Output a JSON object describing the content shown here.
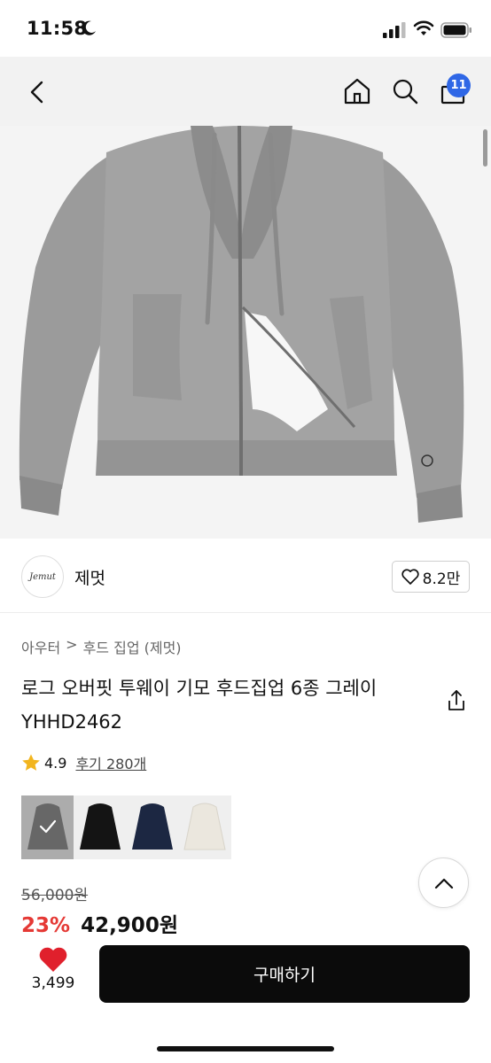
{
  "status_bar": {
    "time": "11:58"
  },
  "nav": {
    "cart_count": "11"
  },
  "brand": {
    "logo_text": "Jemut",
    "name": "제멋",
    "like_count": "8.2만"
  },
  "breadcrumb": {
    "category": "아우터",
    "separator": ">",
    "subcategory": "후드 집업 (제멋)"
  },
  "product": {
    "title": "로그 오버핏 투웨이 기모 후드집업 6종 그레이 YHHD2462",
    "rating": "4.9",
    "review_label": "후기 280개",
    "color_options": [
      {
        "name": "gray",
        "color": "#8f8f8f",
        "selected": true
      },
      {
        "name": "black",
        "color": "#141414",
        "selected": false
      },
      {
        "name": "navy",
        "color": "#1c2742",
        "selected": false
      },
      {
        "name": "ivory",
        "color": "#ebe7de",
        "selected": false
      }
    ],
    "original_price": "56,000원",
    "discount_rate": "23%",
    "sale_price": "42,900원"
  },
  "bottom_bar": {
    "wish_count": "3,499",
    "buy_label": "구매하기"
  },
  "colors": {
    "accent_red": "#e53935",
    "badge_blue": "#2f67e6",
    "buy_button": "#0b0b0b"
  }
}
